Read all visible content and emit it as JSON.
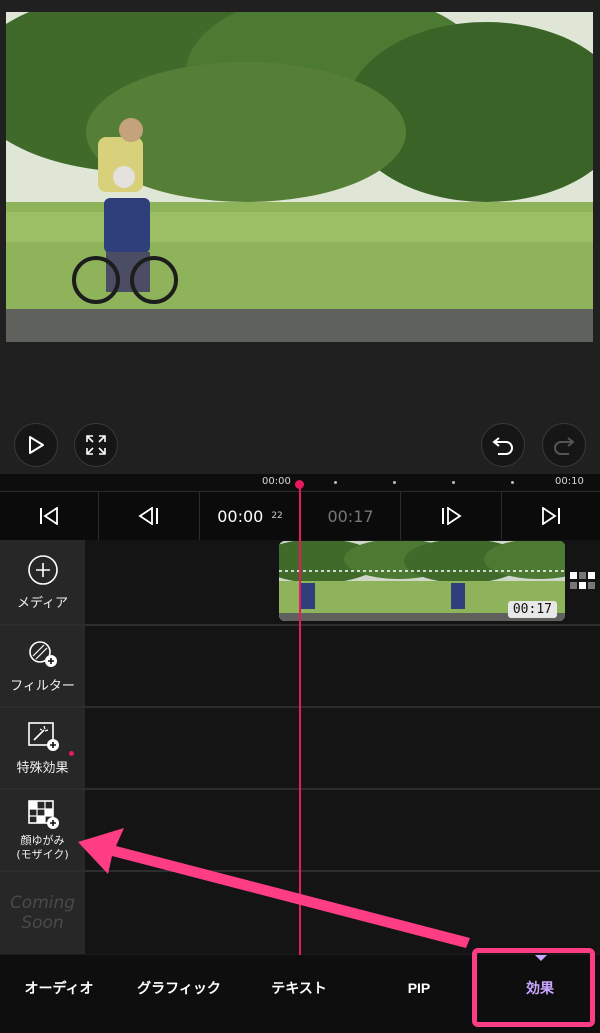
{
  "timeline": {
    "ruler_start": "00:00",
    "ruler_end": "00:10",
    "current_time": "00:00",
    "current_frame": "22",
    "total_time": "00:17",
    "clip_duration": "00:17"
  },
  "tracks": [
    {
      "label": "メディア"
    },
    {
      "label": "フィルター"
    },
    {
      "label": "特殊効果"
    },
    {
      "label_line1": "顔ゆがみ",
      "label_line2": "(モザイク)"
    },
    {
      "label_line1": "Coming",
      "label_line2": "Soon"
    }
  ],
  "tabs": [
    {
      "label": "オーディオ"
    },
    {
      "label": "グラフィック"
    },
    {
      "label": "テキスト"
    },
    {
      "label": "PIP"
    },
    {
      "label": "効果"
    }
  ],
  "colors": {
    "accent": "#e8195c",
    "selected_tab_text": "#c9a6ff",
    "highlight_box": "#ff3d84"
  },
  "icons": {
    "play": "play-icon",
    "fullscreen": "fullscreen-icon",
    "undo": "undo-icon",
    "redo": "redo-icon"
  }
}
